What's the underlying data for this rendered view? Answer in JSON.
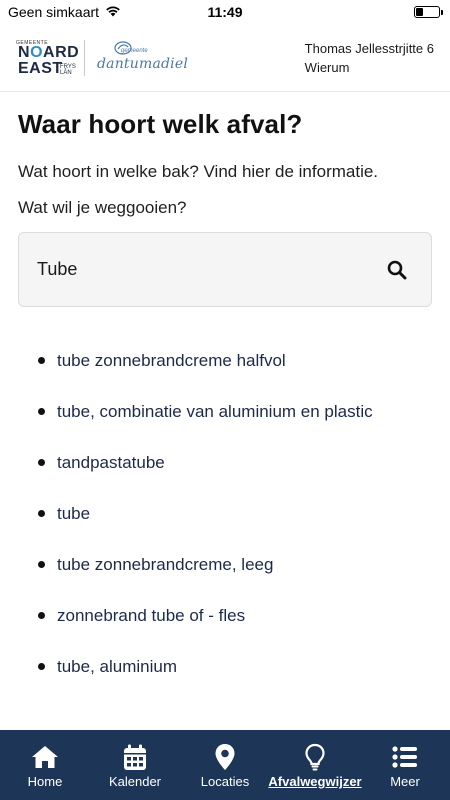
{
  "status_bar": {
    "carrier": "Geen simkaart",
    "time": "11:49"
  },
  "header": {
    "logo_noard_east": {
      "gemeente": "GEMEENTE",
      "noard_n": "N",
      "noard_o": "O",
      "noard_rest": "ARD",
      "east": "EAST",
      "frys_lan": "FRYS LÂN"
    },
    "logo_dantumadiel": {
      "gemeente": "gemeente",
      "name": "dantumadiel"
    },
    "address_line1": "Thomas Jellesstrjitte 6",
    "address_line2": "Wierum"
  },
  "main": {
    "title": "Waar hoort welk afval?",
    "intro": "Wat hoort in welke bak? Vind hier de informatie.",
    "question": "Wat wil je weggooien?",
    "search": {
      "value": "Tube",
      "placeholder": ""
    },
    "results": [
      "tube zonnebrandcreme halfvol",
      "tube, combinatie van aluminium en plastic",
      "tandpastatube",
      "tube",
      "tube zonnebrandcreme, leeg",
      "zonnebrand tube of - fles",
      "tube, aluminium"
    ]
  },
  "bottom_nav": {
    "items": [
      {
        "label": "Home",
        "icon": "home-icon",
        "active": false
      },
      {
        "label": "Kalender",
        "icon": "calendar-icon",
        "active": false
      },
      {
        "label": "Locaties",
        "icon": "location-pin-icon",
        "active": false
      },
      {
        "label": "Afvalwegwijzer",
        "icon": "lightbulb-icon",
        "active": true
      },
      {
        "label": "Meer",
        "icon": "menu-list-icon",
        "active": false
      }
    ]
  },
  "colors": {
    "nav_background": "#1d3556",
    "link_text": "#1c2a4a",
    "search_background": "#f5f5f5"
  }
}
